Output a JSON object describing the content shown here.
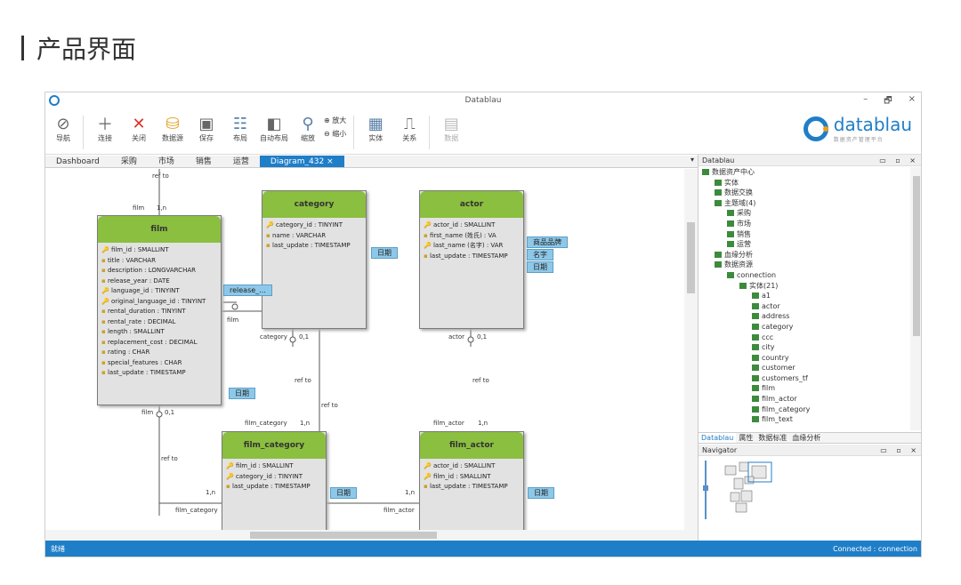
{
  "heading": "产品界面",
  "window": {
    "title": "Datablau",
    "controls": [
      "–",
      "🗗",
      "×"
    ]
  },
  "ribbon": {
    "buttons": [
      {
        "label": "导航",
        "icon": "compass-icon"
      },
      {
        "label": "连接",
        "icon": "plus-icon"
      },
      {
        "label": "关闭",
        "icon": "close-icon"
      },
      {
        "label": "数据源",
        "icon": "database-add-icon"
      },
      {
        "label": "保存",
        "icon": "save-icon"
      },
      {
        "label": "布局",
        "icon": "layout-icon"
      },
      {
        "label": "自动布局",
        "icon": "auto-layout-icon"
      },
      {
        "label": "缩放",
        "icon": "search-icon"
      }
    ],
    "zoom_in": "放大",
    "zoom_out": "缩小",
    "buttons2": [
      {
        "label": "实体",
        "icon": "table-icon"
      },
      {
        "label": "关系",
        "icon": "relation-icon"
      },
      {
        "label": "数据",
        "icon": "data-icon"
      }
    ]
  },
  "brand": {
    "name": "datablau",
    "sub": "数据资产管理平台"
  },
  "tabs": [
    "Dashboard",
    "采购",
    "市场",
    "销售",
    "运营",
    "Diagram_432  ×"
  ],
  "entities": {
    "film": {
      "title": "film",
      "rows": [
        {
          "k": "🔑",
          "t": "film_id : SMALLINT"
        },
        {
          "k": "▪",
          "t": "title : VARCHAR"
        },
        {
          "k": "▪",
          "t": "description : LONGVARCHAR"
        },
        {
          "k": "▪",
          "t": "release_year : DATE"
        },
        {
          "k": "🔑",
          "t": "language_id : TINYINT"
        },
        {
          "k": "🔑",
          "t": "original_language_id : TINYINT"
        },
        {
          "k": "▪",
          "t": "rental_duration : TINYINT"
        },
        {
          "k": "▪",
          "t": "rental_rate : DECIMAL"
        },
        {
          "k": "▪",
          "t": "length : SMALLINT"
        },
        {
          "k": "▪",
          "t": "replacement_cost : DECIMAL"
        },
        {
          "k": "▪",
          "t": "rating : CHAR"
        },
        {
          "k": "▪",
          "t": "special_features : CHAR"
        },
        {
          "k": "▪",
          "t": "last_update : TIMESTAMP"
        }
      ]
    },
    "category": {
      "title": "category",
      "rows": [
        {
          "k": "🔑",
          "t": "category_id : TINYINT"
        },
        {
          "k": "▪",
          "t": "name : VARCHAR"
        },
        {
          "k": "▪",
          "t": "last_update : TIMESTAMP"
        }
      ]
    },
    "actor": {
      "title": "actor",
      "rows": [
        {
          "k": "🔑",
          "t": "actor_id : SMALLINT"
        },
        {
          "k": "▪",
          "t": "first_name (姓氏) : VA"
        },
        {
          "k": "🔑",
          "t": "last_name (名字) : VAR"
        },
        {
          "k": "▪",
          "t": "last_update : TIMESTAMP"
        }
      ]
    },
    "film_category": {
      "title": "film_category",
      "rows": [
        {
          "k": "🔑",
          "t": "film_id : SMALLINT"
        },
        {
          "k": "🔑",
          "t": "category_id : TINYINT"
        },
        {
          "k": "▪",
          "t": "last_update : TIMESTAMP"
        }
      ]
    },
    "film_actor": {
      "title": "film_actor",
      "rows": [
        {
          "k": "🔑",
          "t": "actor_id : SMALLINT"
        },
        {
          "k": "🔑",
          "t": "film_id : SMALLINT"
        },
        {
          "k": "▪",
          "t": "last_update : TIMESTAMP"
        }
      ]
    }
  },
  "tags": {
    "film_date": "日期",
    "film_release": "release_...",
    "category_date": "日期",
    "actor_1": "商品品牌",
    "actor_2": "名字",
    "actor_3": "日期",
    "fc_date": "日期",
    "fa_date": "日期"
  },
  "labels": {
    "ref_to": "ref to",
    "film_top": "film",
    "one_n": "1,n",
    "zero_one": "0,1",
    "category_card": "category",
    "actor_card": "actor",
    "film_bottom": "film",
    "film_category_card": "film_category",
    "film_actor_card": "film_actor",
    "film_r": "film"
  },
  "right_panel": {
    "title": "Datablau",
    "tree": [
      {
        "d": 0,
        "t": "数据资产中心"
      },
      {
        "d": 1,
        "t": "实体"
      },
      {
        "d": 1,
        "t": "数据交换"
      },
      {
        "d": 1,
        "t": "主题域(4)"
      },
      {
        "d": 2,
        "t": "采购"
      },
      {
        "d": 2,
        "t": "市场"
      },
      {
        "d": 2,
        "t": "销售"
      },
      {
        "d": 2,
        "t": "运营"
      },
      {
        "d": 1,
        "t": "血缘分析"
      },
      {
        "d": 1,
        "t": "数据资源"
      },
      {
        "d": 2,
        "t": "connection"
      },
      {
        "d": 3,
        "t": "实体(21)"
      },
      {
        "d": 4,
        "t": "a1"
      },
      {
        "d": 4,
        "t": "actor"
      },
      {
        "d": 4,
        "t": "address"
      },
      {
        "d": 4,
        "t": "category"
      },
      {
        "d": 4,
        "t": "ccc"
      },
      {
        "d": 4,
        "t": "city"
      },
      {
        "d": 4,
        "t": "country"
      },
      {
        "d": 4,
        "t": "customer"
      },
      {
        "d": 4,
        "t": "customers_tf"
      },
      {
        "d": 4,
        "t": "film"
      },
      {
        "d": 4,
        "t": "film_actor"
      },
      {
        "d": 4,
        "t": "film_category"
      },
      {
        "d": 4,
        "t": "film_text"
      }
    ],
    "tabs": [
      "Datablau",
      "属性",
      "数据标准",
      "血缘分析"
    ],
    "navigator_title": "Navigator"
  },
  "status": {
    "left": "就绪",
    "right": "Connected : connection"
  }
}
